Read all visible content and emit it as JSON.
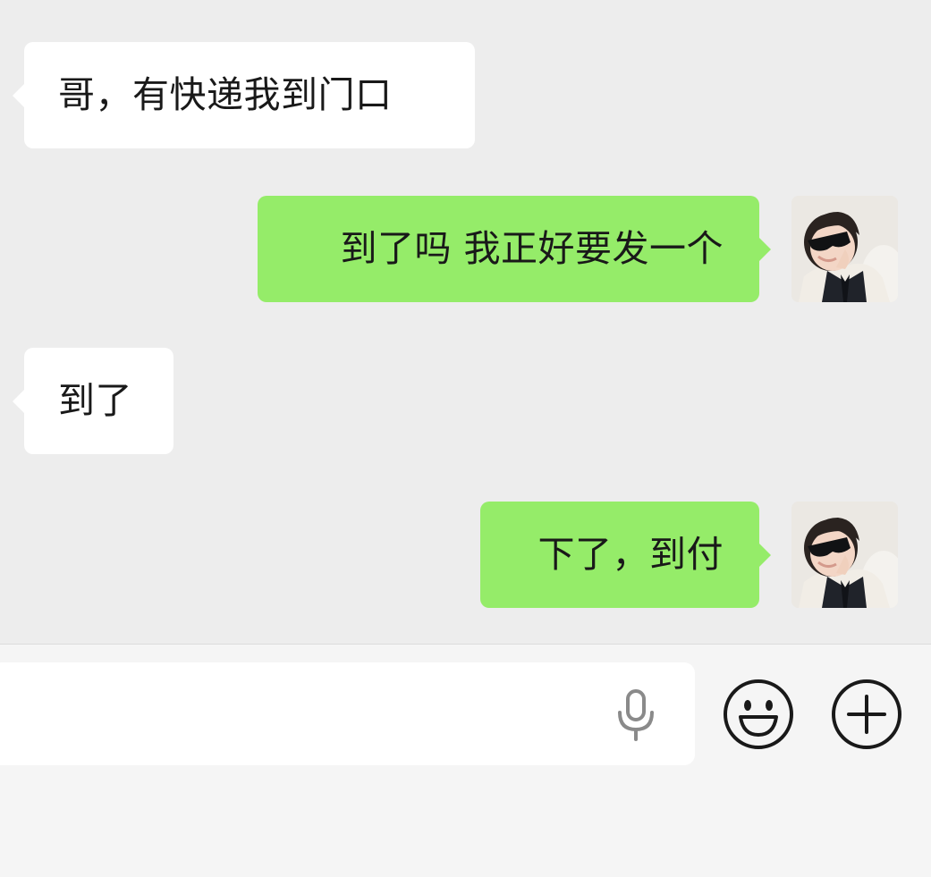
{
  "messages": [
    {
      "direction": "incoming",
      "text": "哥，有快递我到门口"
    },
    {
      "direction": "outgoing",
      "text": "到了吗 我正好要发一个"
    },
    {
      "direction": "incoming",
      "text": "到了"
    },
    {
      "direction": "outgoing",
      "text": "下了，到付"
    }
  ],
  "input": {
    "value": "",
    "placeholder": ""
  },
  "icons": {
    "avatar": "user-avatar-boy-sunglasses",
    "voice": "microphone-icon",
    "emoji": "emoji-smile-icon",
    "more": "plus-circle-icon"
  },
  "colors": {
    "chat_background": "#ededed",
    "incoming_bubble": "#ffffff",
    "outgoing_bubble": "#95ec69",
    "text": "#191919"
  }
}
